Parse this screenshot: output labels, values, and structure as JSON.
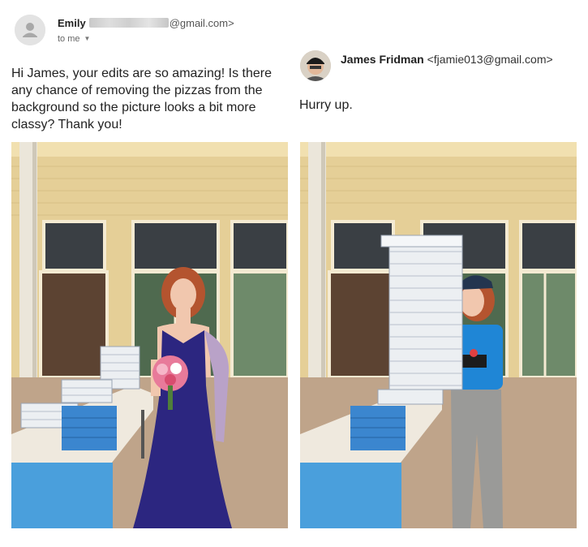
{
  "left_email": {
    "sender_name": "Emily",
    "sender_email_suffix": "@gmail.com>",
    "to_label": "to me",
    "message": "Hi James, your edits are so amazing! Is there any chance of removing the pizzas from the background so the picture looks a bit more classy? Thank you!",
    "icons": [
      "default-avatar-icon",
      "chevron-down-icon"
    ]
  },
  "right_email": {
    "sender_name": "James Fridman",
    "sender_email": "<fjamie013@gmail.com>",
    "message": "Hurry up.",
    "icons": [
      "avatar-photo"
    ]
  },
  "colors": {
    "wall": "#e8d39c",
    "dress": "#2c2680",
    "pizza_box": "#eceff2",
    "uniform": "#1f86d6",
    "tablecloth": "#4a9fdc"
  }
}
